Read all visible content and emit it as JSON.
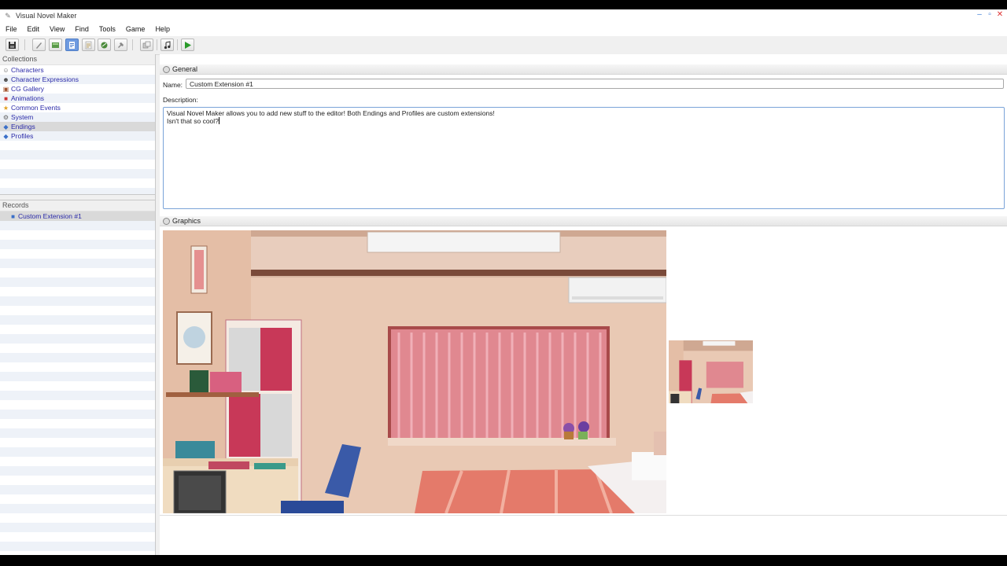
{
  "window": {
    "title": "Visual Novel Maker"
  },
  "menu": [
    "File",
    "Edit",
    "View",
    "Find",
    "Tools",
    "Game",
    "Help"
  ],
  "sidebar": {
    "collections_label": "Collections",
    "collections": [
      {
        "label": "Characters",
        "icon": "character-icon"
      },
      {
        "label": "Character Expressions",
        "icon": "expression-icon"
      },
      {
        "label": "CG Gallery",
        "icon": "gallery-icon"
      },
      {
        "label": "Animations",
        "icon": "animation-icon"
      },
      {
        "label": "Common Events",
        "icon": "star-icon"
      },
      {
        "label": "System",
        "icon": "gear-icon"
      },
      {
        "label": "Endings",
        "icon": "extension-icon",
        "selected": true
      },
      {
        "label": "Profiles",
        "icon": "extension-icon"
      }
    ],
    "records_label": "Records",
    "records": [
      {
        "label": "Custom Extension #1",
        "icon": "record-icon",
        "selected": true
      }
    ]
  },
  "general": {
    "header": "General",
    "name_label": "Name:",
    "name_value": "Custom Extension #1",
    "description_label": "Description:",
    "description_line1": "Visual Novel Maker allows you to add new stuff to the editor! Both Endings and Profiles are custom extensions!",
    "description_line2": "Isn't that so cool?"
  },
  "graphics": {
    "header": "Graphics"
  },
  "colors": {
    "accent": "#6f9be0",
    "link_text": "#2a2aa8",
    "focus_border": "#7aa3d8"
  }
}
